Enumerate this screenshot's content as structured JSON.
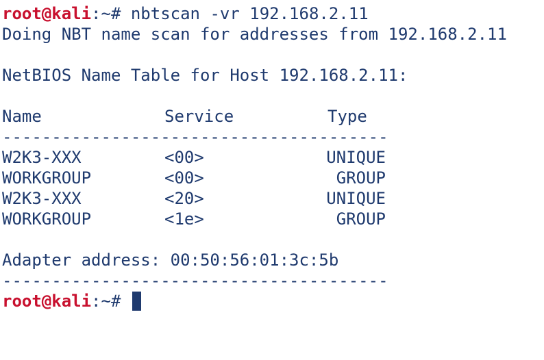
{
  "prompt": {
    "user_host": "root@kali",
    "separator": ":",
    "path": "~",
    "symbol": "# "
  },
  "command": "nbtscan -vr 192.168.2.11",
  "scan_message": "Doing NBT name scan for addresses from 192.168.2.11",
  "table_title": "NetBIOS Name Table for Host 192.168.2.11:",
  "headers": {
    "name": "Name",
    "service": "Service",
    "type": "Type"
  },
  "separator_line": "---------------------------------------",
  "rows": [
    {
      "name": "W2K3-XXX",
      "service": "<00>",
      "type": "UNIQUE"
    },
    {
      "name": "WORKGROUP",
      "service": "<00>",
      "type": "GROUP"
    },
    {
      "name": "W2K3-XXX",
      "service": "<20>",
      "type": "UNIQUE"
    },
    {
      "name": "WORKGROUP",
      "service": "<1e>",
      "type": "GROUP"
    }
  ],
  "adapter_line": "Adapter address: 00:50:56:01:3c:5b",
  "colors": {
    "prompt_user": "#c8102e",
    "text": "#1f3a6e",
    "background": "#ffffff"
  }
}
